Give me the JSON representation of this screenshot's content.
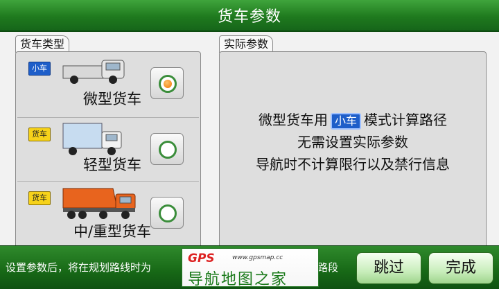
{
  "header": {
    "title": "货车参数"
  },
  "left_panel": {
    "tab_label": "货车类型",
    "vehicles": [
      {
        "badge": "小车",
        "badge_color": "#1e5ec9",
        "label": "微型货车",
        "selected": true
      },
      {
        "badge": "货车",
        "badge_color": "#f6d21a",
        "label": "轻型货车",
        "selected": false
      },
      {
        "badge": "货车",
        "badge_color": "#f6d21a",
        "label": "中/重型货车",
        "selected": false
      }
    ]
  },
  "right_panel": {
    "tab_label": "实际参数",
    "line1_prefix": "微型货车用",
    "line1_badge": "小车",
    "line1_suffix": "模式计算路径",
    "line2": "无需设置实际参数",
    "line3": "导航时不计算限行以及禁行信息"
  },
  "footer": {
    "hint_left": "设置参数后，将在规划路线时为",
    "hint_right": "路段",
    "skip_label": "跳过",
    "done_label": "完成"
  },
  "watermark": {
    "brand": "GPS",
    "url": "www.gpsmap.cc",
    "text": "导航地图之家"
  },
  "colors": {
    "accent_green": "#1f7a1e",
    "radio_selected": "#f07400"
  }
}
